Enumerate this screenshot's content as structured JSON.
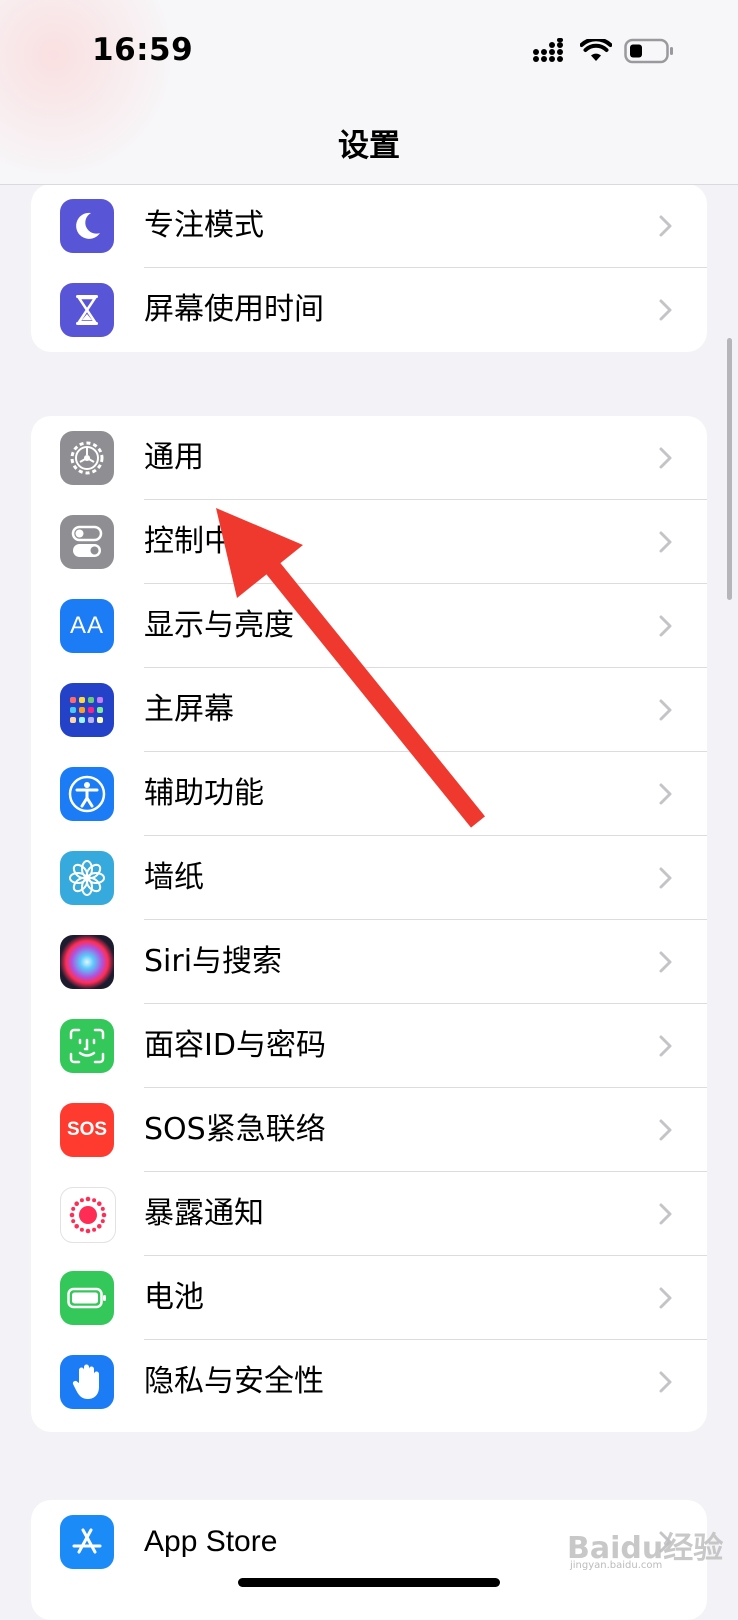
{
  "status_bar": {
    "time": "16:59"
  },
  "nav": {
    "title": "设置"
  },
  "group1": [
    {
      "label": "专注模式",
      "icon": "moon-icon",
      "color": "#5856d6"
    },
    {
      "label": "屏幕使用时间",
      "icon": "hourglass-icon",
      "color": "#5856d6"
    }
  ],
  "group2": [
    {
      "label": "通用",
      "icon": "gear-icon",
      "color": "#8e8e93"
    },
    {
      "label": "控制中心",
      "icon": "toggles-icon",
      "color": "#8e8e93"
    },
    {
      "label": "显示与亮度",
      "icon": "aa-icon",
      "color": "#1b7cf5"
    },
    {
      "label": "主屏幕",
      "icon": "home-grid-icon",
      "color": "#2342c8"
    },
    {
      "label": "辅助功能",
      "icon": "accessibility-icon",
      "color": "#1b7cf5"
    },
    {
      "label": "墙纸",
      "icon": "flower-icon",
      "color": "#36aadc"
    },
    {
      "label": "Siri与搜索",
      "icon": "siri-icon",
      "color": "#1a1a2e"
    },
    {
      "label": "面容ID与密码",
      "icon": "face-id-icon",
      "color": "#34c759"
    },
    {
      "label": "SOS紧急联络",
      "icon": "sos-icon",
      "color": "#ff3b30"
    },
    {
      "label": "暴露通知",
      "icon": "exposure-icon",
      "color": "#ffffff"
    },
    {
      "label": "电池",
      "icon": "battery-icon",
      "color": "#34c759"
    },
    {
      "label": "隐私与安全性",
      "icon": "hand-icon",
      "color": "#1b7cf5"
    }
  ],
  "group3": [
    {
      "label": "App Store",
      "icon": "app-store-icon",
      "color": "#1b8cf7"
    }
  ],
  "icon_text": {
    "sos": "SOS",
    "aa": "AA"
  },
  "watermark": {
    "brand": "Baidu经验",
    "url": "jingyan.baidu.com"
  }
}
